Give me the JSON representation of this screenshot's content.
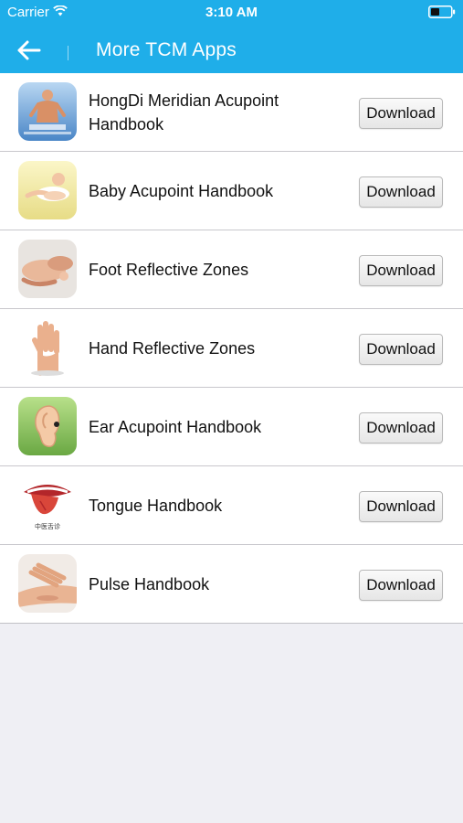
{
  "status_bar": {
    "carrier": "Carrier",
    "time": "3:10 AM",
    "wifi_icon": "wifi-icon",
    "battery_icon": "battery-icon"
  },
  "navbar": {
    "title": "More TCM Apps",
    "back_icon": "arrow-left-icon",
    "background_color": "#1faee9"
  },
  "apps": [
    {
      "name": "HongDi Meridian Acupoint Handbook",
      "button": "Download",
      "icon": "meridian-acupoint-icon"
    },
    {
      "name": "Baby Acupoint Handbook",
      "button": "Download",
      "icon": "baby-acupoint-icon"
    },
    {
      "name": "Foot Reflective Zones",
      "button": "Download",
      "icon": "foot-reflective-icon"
    },
    {
      "name": "Hand Reflective Zones",
      "button": "Download",
      "icon": "hand-reflective-icon"
    },
    {
      "name": "Ear Acupoint Handbook",
      "button": "Download",
      "icon": "ear-acupoint-icon"
    },
    {
      "name": "Tongue Handbook",
      "button": "Download",
      "icon": "tongue-icon"
    },
    {
      "name": "Pulse Handbook",
      "button": "Download",
      "icon": "pulse-icon"
    }
  ],
  "tongue_icon_caption": "中医舌诊"
}
